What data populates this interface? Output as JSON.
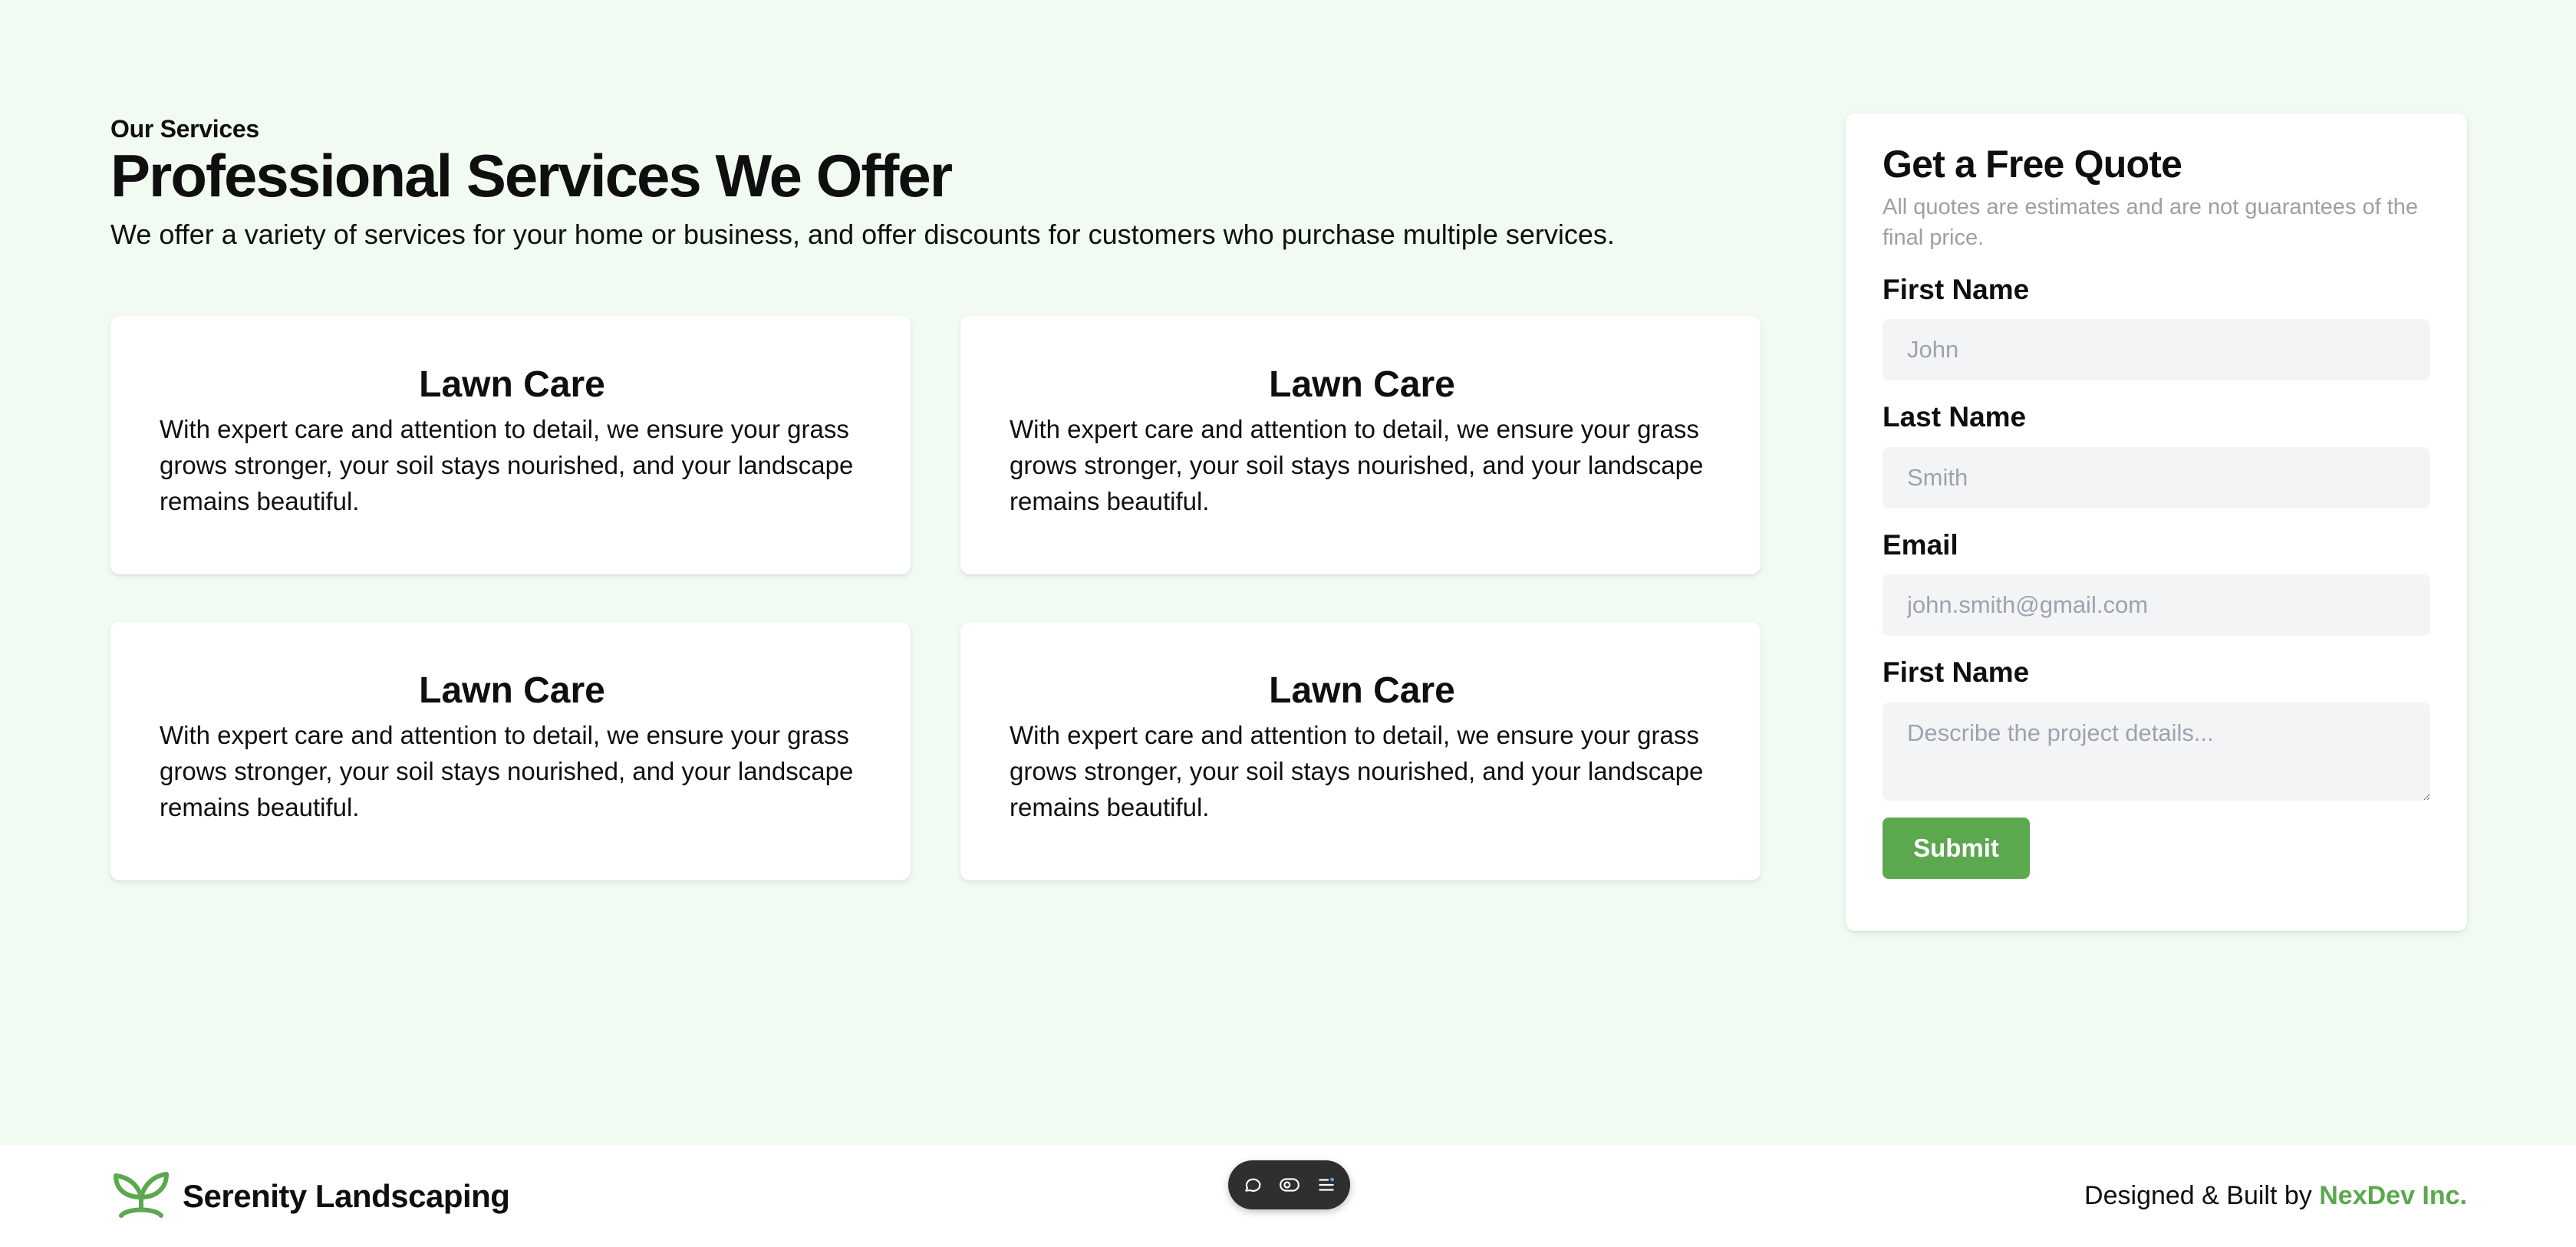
{
  "services": {
    "eyebrow": "Our Services",
    "title": "Professional Services We Offer",
    "description": "We offer a variety of services for your home or business, and offer discounts for customers who purchase multiple services.",
    "cards": [
      {
        "title": "Lawn Care",
        "text": "With expert care and attention to detail, we ensure your grass grows stronger, your soil stays nourished, and your landscape remains beautiful."
      },
      {
        "title": "Lawn Care",
        "text": "With expert care and attention to detail, we ensure your grass grows stronger, your soil stays nourished, and your landscape remains beautiful."
      },
      {
        "title": "Lawn Care",
        "text": "With expert care and attention to detail, we ensure your grass grows stronger, your soil stays nourished, and your landscape remains beautiful."
      },
      {
        "title": "Lawn Care",
        "text": "With expert care and attention to detail, we ensure your grass grows stronger, your soil stays nourished, and your landscape remains beautiful."
      }
    ]
  },
  "quote": {
    "title": "Get a Free Quote",
    "subtitle": "All quotes are estimates and are not guarantees of the final price.",
    "fields": [
      {
        "label": "First Name",
        "placeholder": "John"
      },
      {
        "label": "Last Name",
        "placeholder": "Smith"
      },
      {
        "label": "Email",
        "placeholder": "john.smith@gmail.com"
      },
      {
        "label": "First Name",
        "placeholder": "Describe the project details..."
      }
    ],
    "submit_label": "Submit"
  },
  "footer": {
    "brand_name": "Serenity Landscaping",
    "credit_prefix": "Designed & Built by",
    "credit_link": "NexDev Inc."
  },
  "toolbar": {
    "icons": [
      "comment-icon",
      "toggle-icon",
      "menu-icon"
    ]
  },
  "colors": {
    "page_background": "#f1fbf2",
    "accent": "#5ba84f",
    "card_background": "#ffffff",
    "input_background": "#f3f4f6",
    "toolbar_background": "#2f2f2f"
  }
}
